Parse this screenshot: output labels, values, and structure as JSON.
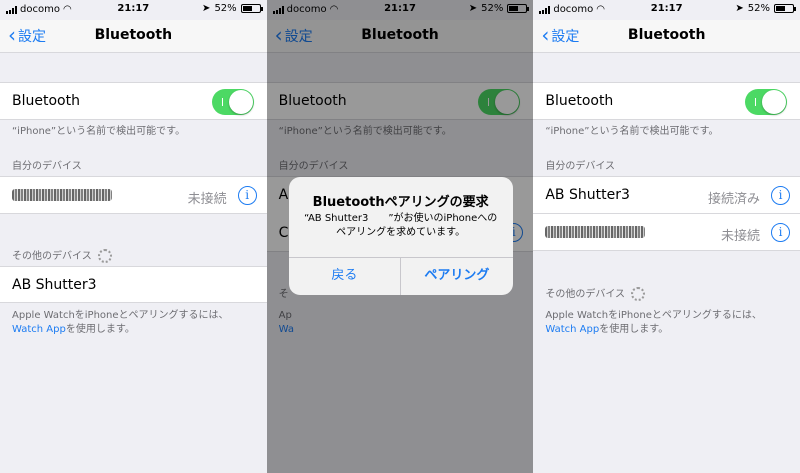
{
  "status": {
    "carrier": "docomo",
    "time": "21:17",
    "battery": "52%"
  },
  "nav": {
    "back": "設定",
    "title": "Bluetooth"
  },
  "bluetooth_row": {
    "label": "Bluetooth",
    "on": true
  },
  "discoverable_note": "“iPhone”という名前で検出可能です。",
  "my_devices_header": "自分のデバイス",
  "other_devices_header": "その他のデバイス",
  "status_not_connected": "未接続",
  "status_connected": "接続済み",
  "device_ab_shutter": "AB Shutter3",
  "info_glyph": "i",
  "watch_note": {
    "line1": "Apple WatchをiPhoneとペアリングするには、",
    "link": "Watch App",
    "suffix": "を使用します。"
  },
  "dialog": {
    "title": "Bluetoothペアリングの要求",
    "message_line1": "“AB Shutter3　　”がお使いのiPhoneへの",
    "message_line2": "ペアリングを求めています。",
    "cancel": "戻る",
    "pair": "ペアリング"
  },
  "obscured_peek": {
    "row1": "A",
    "row2": "C",
    "other": "そ",
    "apple": "Ap",
    "watch": "Wa"
  },
  "colors": {
    "accent": "#1d7cf2",
    "toggle_on": "#4cd964",
    "background": "#efeff4"
  }
}
